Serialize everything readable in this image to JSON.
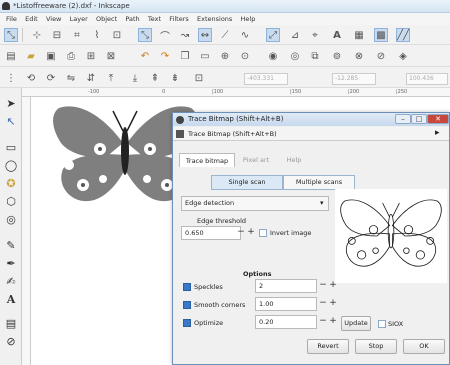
{
  "window": {
    "title": "*Listoffreeware (2).dxf - Inkscape"
  },
  "menu": [
    "File",
    "Edit",
    "View",
    "Layer",
    "Object",
    "Path",
    "Text",
    "Filters",
    "Extensions",
    "Help"
  ],
  "toolbar_coords": {
    "x": "-403.331",
    "y": "-12.285",
    "w": "100.436"
  },
  "ruler": {
    "labels": [
      "-100",
      "0",
      "|100",
      "|150",
      "|200",
      "|250"
    ]
  },
  "dialog": {
    "title": "Trace Bitmap (Shift+Alt+B)",
    "subtitle": "Trace Bitmap (Shift+Alt+B)",
    "tabs": [
      "Trace bitmap",
      "Pixel art",
      "Help"
    ],
    "modes": [
      "Single scan",
      "Multiple scans"
    ],
    "detection_mode": "Edge detection",
    "edge_threshold_label": "Edge threshold",
    "edge_threshold_value": "0.650",
    "invert_label": "Invert image",
    "options_heading": "Options",
    "speckles_label": "Speckles",
    "speckles_value": "2",
    "smooth_label": "Smooth corners",
    "smooth_value": "1.00",
    "optimize_label": "Optimize",
    "optimize_value": "0.20",
    "update_label": "Update",
    "siox_label": "SIOX",
    "revert_label": "Revert",
    "stop_label": "Stop",
    "ok_label": "OK"
  }
}
